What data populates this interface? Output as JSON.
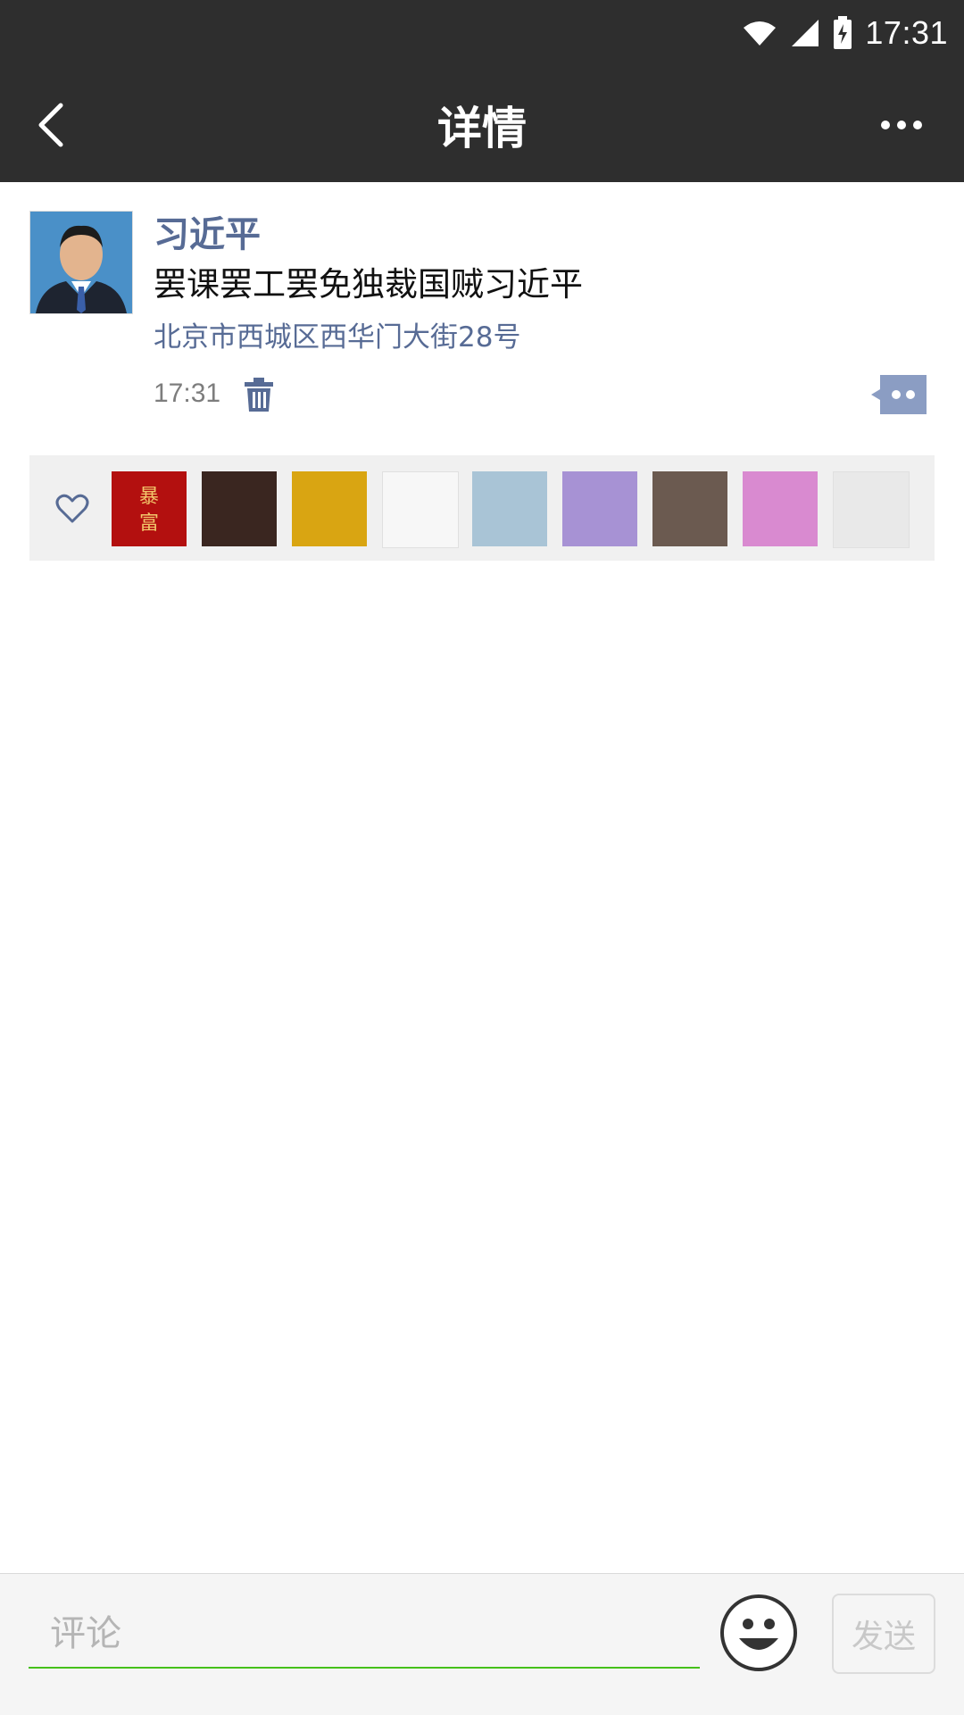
{
  "status_bar": {
    "time": "17:31"
  },
  "header": {
    "title": "详情"
  },
  "post": {
    "author": "习近平",
    "content": "罢课罢工罢免独裁国贼习近平",
    "location": "北京市西城区西华门大街28号",
    "time": "17:31"
  },
  "likes": {
    "avatars": [
      {
        "label": "暴富",
        "color": "#b3100f"
      },
      {
        "label": "",
        "color": "#3a2620"
      },
      {
        "label": "",
        "color": "#d9a512"
      },
      {
        "label": "",
        "color": "#f7f7f7"
      },
      {
        "label": "",
        "color": "#a9c4d6"
      },
      {
        "label": "",
        "color": "#a792d4"
      },
      {
        "label": "",
        "color": "#6b5a50"
      },
      {
        "label": "",
        "color": "#d98ad0"
      },
      {
        "label": "",
        "color": "#e9e9e9"
      }
    ]
  },
  "composer": {
    "placeholder": "评论",
    "value": "",
    "send_label": "发送"
  },
  "colors": {
    "bar": "#2e2e2e",
    "link": "#576b95",
    "accent": "#45c01a"
  }
}
